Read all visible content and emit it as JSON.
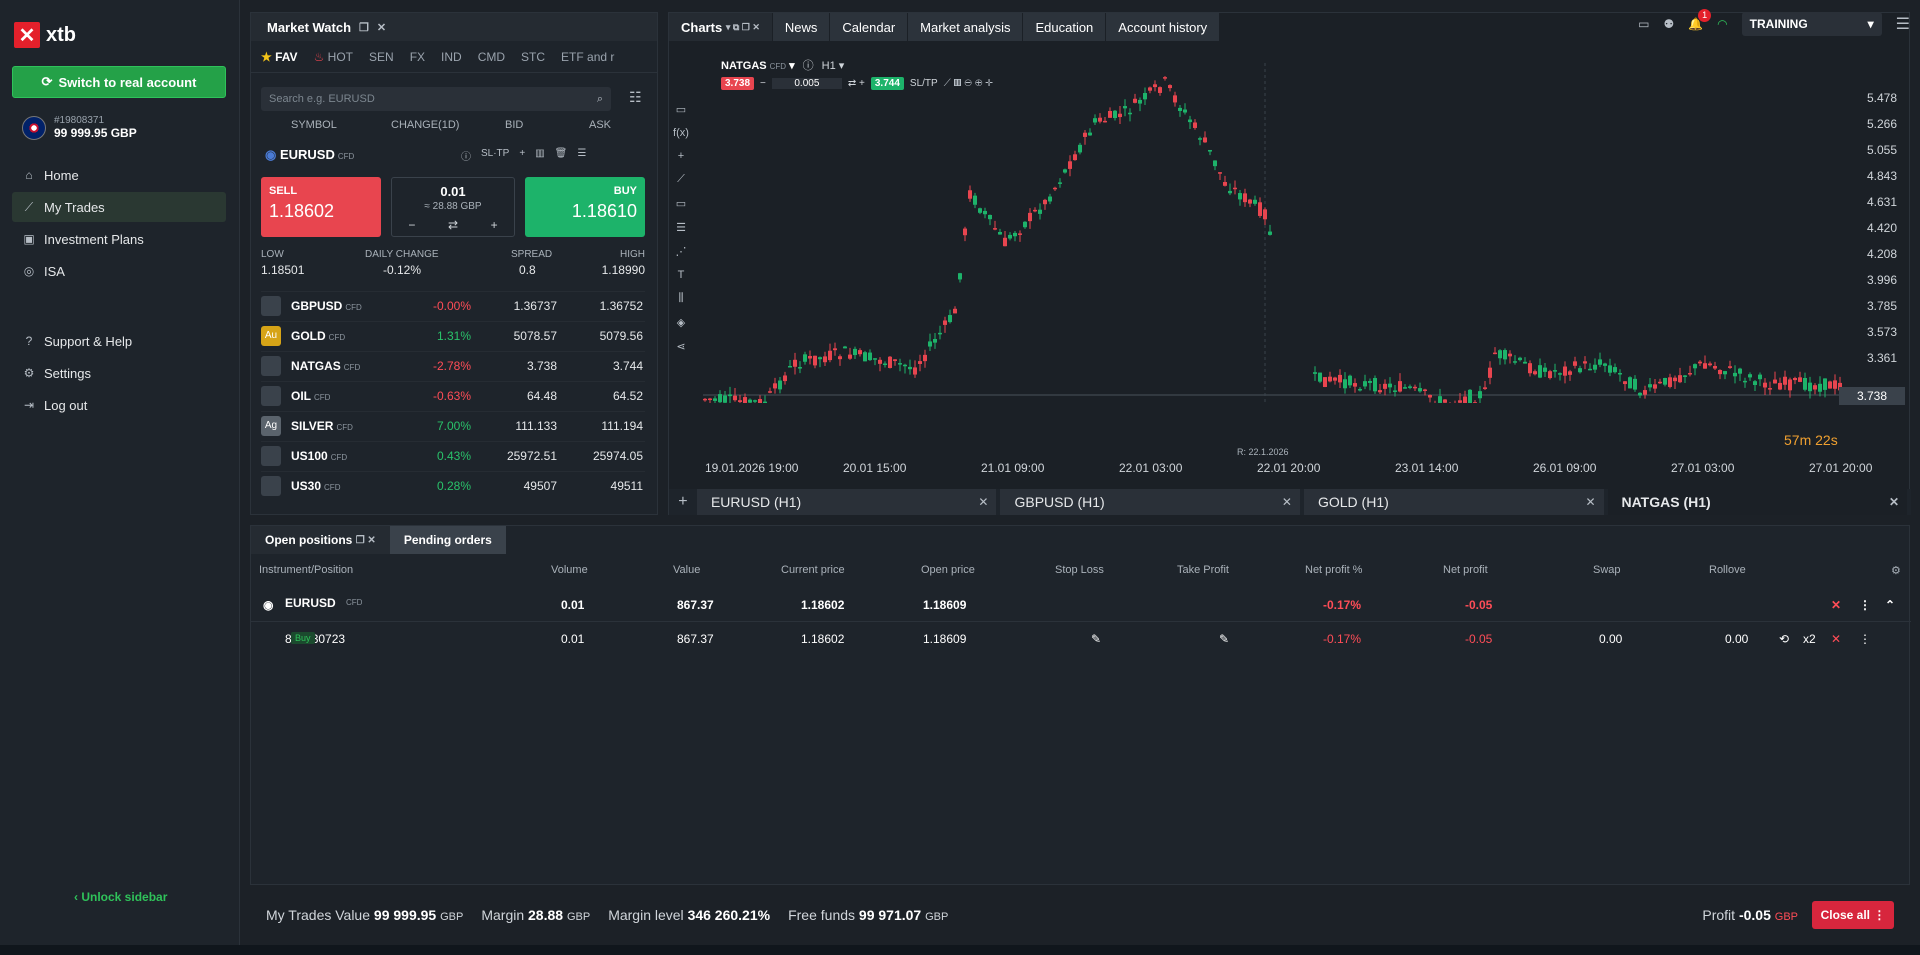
{
  "app": {
    "logo": "xtb"
  },
  "sidebar": {
    "switch_label": "Switch to real account",
    "account_number": "#19808371",
    "balance": "99 999.95 GBP",
    "nav": [
      {
        "label": "Home",
        "icon": "home-icon"
      },
      {
        "label": "My Trades",
        "icon": "trades-icon"
      },
      {
        "label": "Investment Plans",
        "icon": "plans-icon"
      },
      {
        "label": "ISA",
        "icon": "isa-icon"
      }
    ],
    "nav2": [
      {
        "label": "Support & Help",
        "icon": "help-icon"
      },
      {
        "label": "Settings",
        "icon": "gear-icon"
      },
      {
        "label": "Log out",
        "icon": "logout-icon"
      }
    ],
    "unlock": "Unlock sidebar"
  },
  "market_watch": {
    "title": "Market Watch",
    "tabs": [
      "FAV",
      "HOT",
      "SEN",
      "FX",
      "IND",
      "CMD",
      "STC",
      "ETF and r"
    ],
    "search_placeholder": "Search e.g. EURUSD",
    "columns": [
      "SYMBOL",
      "CHANGE(1D)",
      "BID",
      "ASK"
    ],
    "selected": {
      "symbol": "EURUSD",
      "type": "CFD",
      "sltp": "SL·TP",
      "sell_label": "SELL",
      "sell_price": "1.18602",
      "buy_label": "BUY",
      "buy_price": "1.18610",
      "volume": "0.01",
      "volume_gbp": "≈ 28.88 GBP",
      "low_label": "LOW",
      "low": "1.18501",
      "change_label": "DAILY CHANGE",
      "change": "-0.12%",
      "spread_label": "SPREAD",
      "spread": "0.8",
      "high_label": "HIGH",
      "high": "1.18990"
    },
    "rows": [
      {
        "symbol": "GBPUSD",
        "type": "CFD",
        "change": "-0.00%",
        "bid": "1.36737",
        "ask": "1.36752",
        "dir": "neg",
        "icon": ""
      },
      {
        "symbol": "GOLD",
        "type": "CFD",
        "change": "1.31%",
        "bid": "5078.57",
        "ask": "5079.56",
        "dir": "pos",
        "icon": "Au"
      },
      {
        "symbol": "NATGAS",
        "type": "CFD",
        "change": "-2.78%",
        "bid": "3.738",
        "ask": "3.744",
        "dir": "neg",
        "icon": ""
      },
      {
        "symbol": "OIL",
        "type": "CFD",
        "change": "-0.63%",
        "bid": "64.48",
        "ask": "64.52",
        "dir": "neg",
        "icon": ""
      },
      {
        "symbol": "SILVER",
        "type": "CFD",
        "change": "7.00%",
        "bid": "111.133",
        "ask": "111.194",
        "dir": "pos",
        "icon": "Ag"
      },
      {
        "symbol": "US100",
        "type": "CFD",
        "change": "0.43%",
        "bid": "25972.51",
        "ask": "25974.05",
        "dir": "pos",
        "icon": ""
      },
      {
        "symbol": "US30",
        "type": "CFD",
        "change": "0.28%",
        "bid": "49507",
        "ask": "49511",
        "dir": "pos",
        "icon": ""
      }
    ]
  },
  "charts": {
    "tabs": [
      "Charts",
      "News",
      "Calendar",
      "Market analysis",
      "Education",
      "Account history"
    ],
    "symbol": "NATGAS",
    "type": "CFD",
    "interval": "H1",
    "sell_price": "3.738",
    "volume": "0.005",
    "buy_price": "3.744",
    "sltp": "SL/TP",
    "price_axis": [
      "5.478",
      "5.266",
      "5.055",
      "4.843",
      "4.631",
      "4.420",
      "4.208",
      "3.996",
      "3.785",
      "3.573",
      "3.361"
    ],
    "current_price": "3.738",
    "countdown_min": "57m",
    "countdown_sec": "22s",
    "time_axis": [
      "19.01.2026 19:00",
      "20.01 15:00",
      "21.01 09:00",
      "22.01 03:00",
      "22.01 20:00",
      "23.01 14:00",
      "26.01 09:00",
      "27.01 03:00",
      "27.01 20:00"
    ],
    "cursor_label": "R: 22.1.2026",
    "chart_tabs": [
      "EURUSD (H1)",
      "GBPUSD (H1)",
      "GOLD (H1)",
      "NATGAS (H1)"
    ]
  },
  "topbar": {
    "notifications": "1",
    "account_mode": "TRAINING"
  },
  "positions": {
    "tab_open": "Open positions",
    "tab_pending": "Pending orders",
    "columns": [
      "Instrument/Position",
      "Volume",
      "Value",
      "Current price",
      "Open price",
      "Stop Loss",
      "Take Profit",
      "Net profit %",
      "Net profit",
      "Swap",
      "Rollove"
    ],
    "group": {
      "symbol": "EURUSD",
      "type": "CFD",
      "volume": "0.01",
      "value": "867.37",
      "current": "1.18602",
      "open": "1.18609",
      "net_pct": "-0.17%",
      "net": "-0.05"
    },
    "row": {
      "id": "845930723",
      "side": "Buy",
      "volume": "0.01",
      "value": "867.37",
      "current": "1.18602",
      "open": "1.18609",
      "net_pct": "-0.17%",
      "net": "-0.05",
      "swap": "0.00",
      "rollover": "0.00",
      "multiplier": "x2"
    }
  },
  "footer": {
    "trades_label": "My Trades Value",
    "trades_value": "99 999.95",
    "cur": "GBP",
    "margin_label": "Margin",
    "margin": "28.88",
    "level_label": "Margin level",
    "level": "346 260.21%",
    "free_label": "Free funds",
    "free": "99 971.07",
    "profit_label": "Profit",
    "profit": "-0.05",
    "close_all": "Close all"
  },
  "colors": {
    "sell": "#e8454f",
    "buy": "#1db36a",
    "accent": "#24a148",
    "neg": "#ff4d57",
    "pos": "#29c26a"
  }
}
